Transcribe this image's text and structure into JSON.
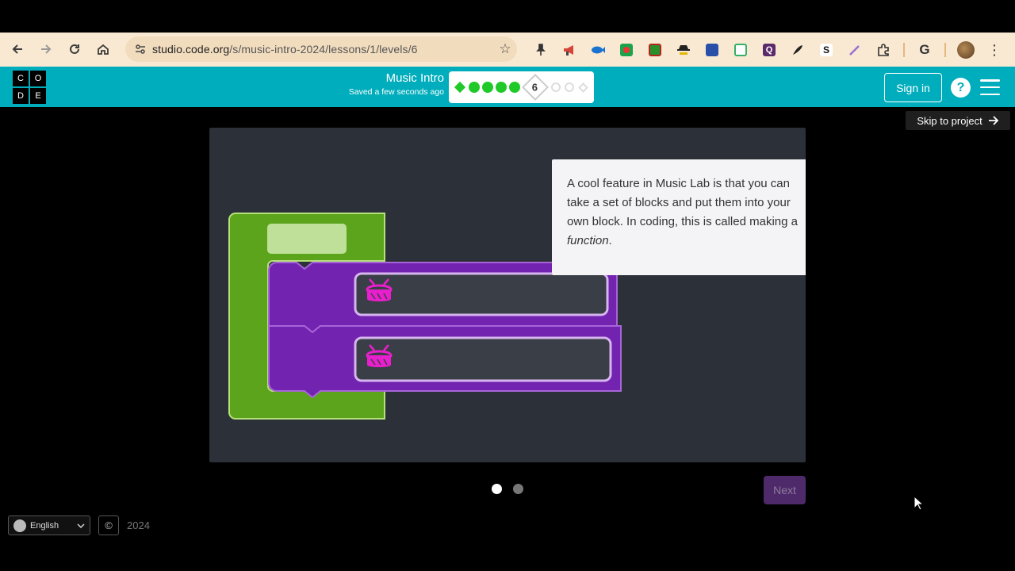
{
  "browser": {
    "url_host": "studio.code.org",
    "url_path": "/s/music-intro-2024/lessons/1/levels/6"
  },
  "header": {
    "logo_letters": [
      "C",
      "O",
      "D",
      "E"
    ],
    "lesson_title": "Music Intro",
    "saved_status": "Saved a few seconds ago",
    "current_level": "6",
    "sign_in_label": "Sign in",
    "help_label": "?"
  },
  "main": {
    "skip_label": "Skip to project",
    "tooltip_text_pre": "A cool feature in Music Lab is that you can take a set of blocks and put them into your own block. In coding, this is called making a ",
    "tooltip_text_em": "function",
    "tooltip_text_post": ".",
    "next_label": "Next",
    "pager_total": 2,
    "pager_current": 1
  },
  "footer": {
    "language": "English",
    "year": "2024"
  },
  "colors": {
    "header_teal": "#00adbc",
    "block_green": "#5ba41c",
    "block_purple": "#7223b0",
    "instrument_magenta": "#e81fcc",
    "progress_green": "#1ec928"
  }
}
